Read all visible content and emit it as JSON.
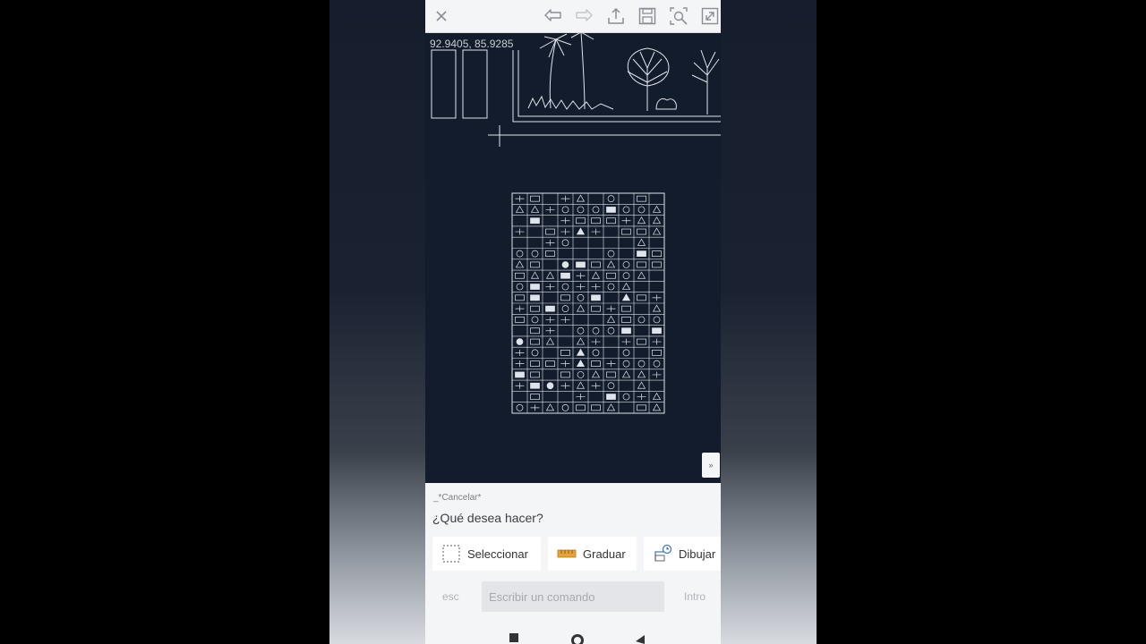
{
  "toolbar": {
    "close_icon": "close-icon",
    "undo_icon": "undo-icon",
    "redo_icon": "redo-icon",
    "share_icon": "upload-icon",
    "save_icon": "save-icon",
    "zoom_icon": "zoom-extents-icon",
    "fullscreen_icon": "expand-icon"
  },
  "canvas": {
    "coordinates": "92.9405, 85.9285",
    "background": "#131c2c",
    "line_color": "#dfe3ea"
  },
  "command_panel": {
    "last_command": "_*Cancelar*",
    "prompt": "¿Qué desea hacer?",
    "actions": [
      {
        "label": "Seleccionar",
        "icon": "select-box-icon"
      },
      {
        "label": "Graduar",
        "icon": "ruler-icon"
      },
      {
        "label": "Dibujar",
        "icon": "draw-icon"
      }
    ],
    "esc_label": "esc",
    "command_placeholder": "Escribir un comando",
    "enter_label": "Intro",
    "collapse_icon": "chevron-up-double-icon"
  },
  "colors": {
    "accent_ruler": "#e8a23a",
    "toolbar_icon": "#8a8f96"
  }
}
